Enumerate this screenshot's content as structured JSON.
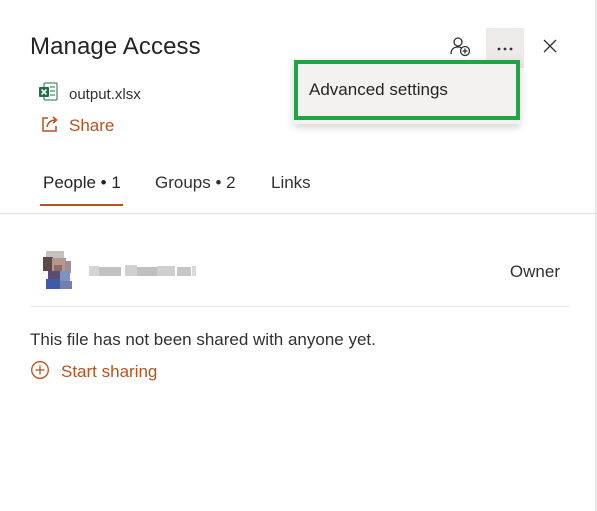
{
  "panel": {
    "title": "Manage Access",
    "file": {
      "name": "output.xlsx",
      "icon": "excel-file-icon"
    },
    "share_label": "Share",
    "toolbar": {
      "add_people_icon": "add-person-icon",
      "more_icon": "more-options-icon",
      "close_icon": "close-icon"
    }
  },
  "menu": {
    "items": [
      {
        "label": "Advanced settings",
        "highlighted": true
      }
    ],
    "highlight_color": "#21a544"
  },
  "tabs": [
    {
      "label": "People • 1",
      "active": true
    },
    {
      "label": "Groups • 2",
      "active": false
    },
    {
      "label": "Links",
      "active": false
    }
  ],
  "people": {
    "owner": {
      "name": "Kasun Polani",
      "role": "Owner",
      "name_blurred": true
    }
  },
  "empty_state": {
    "message": "This file has not been shared with anyone yet.",
    "action_label": "Start sharing"
  },
  "colors": {
    "accent": "#b5521f",
    "text": "#323130",
    "excel_green": "#1d6f42"
  }
}
